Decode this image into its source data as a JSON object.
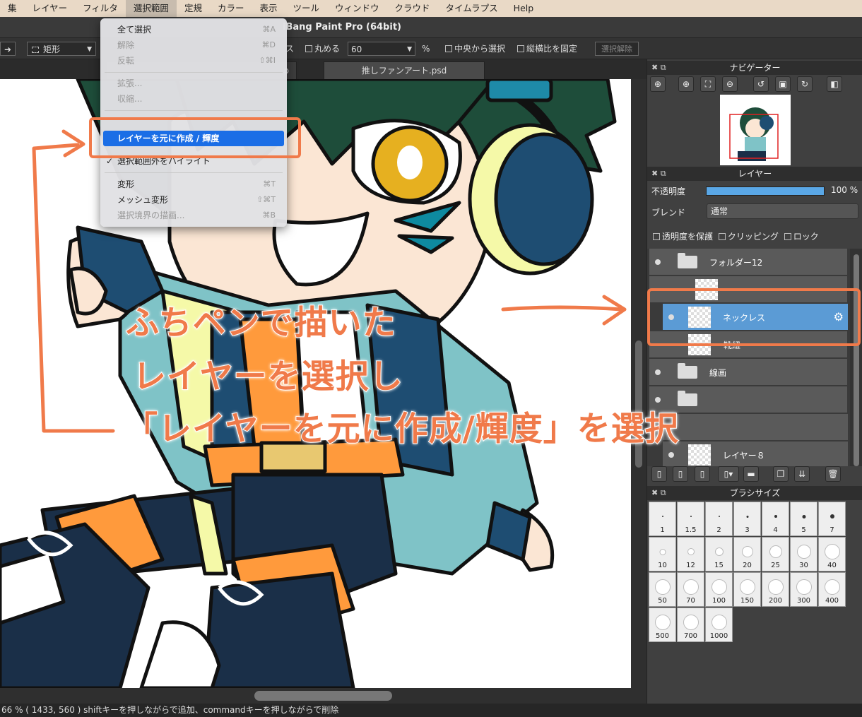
{
  "menubar": {
    "items": [
      "集",
      "レイヤー",
      "フィルタ",
      "選択範囲",
      "定規",
      "カラー",
      "表示",
      "ツール",
      "ウィンドウ",
      "クラウド",
      "タイムラプス",
      "Help"
    ],
    "active": "選択範囲"
  },
  "window": {
    "title": "iBang Paint Pro (64bit)"
  },
  "toolbar": {
    "arrow_icon": "arrow-right-icon",
    "shape_select": "矩形",
    "clip_text": "ス",
    "round_label": "丸める",
    "round_value": "60",
    "percent": "%",
    "center_label": "中央から選択",
    "aspect_label": "縦横比を固定",
    "deselect_label": "選択解除"
  },
  "tabs": {
    "left_fragment": "p",
    "active": "推しファンアート.psd"
  },
  "menu": {
    "select_all": {
      "label": "全て選択",
      "shortcut": "⌘A"
    },
    "deselect": {
      "label": "解除",
      "shortcut": "⌘D"
    },
    "invert": {
      "label": "反転",
      "shortcut": "⇧⌘I"
    },
    "expand": {
      "label": "拡張..."
    },
    "shrink": {
      "label": "収縮..."
    },
    "create_from_layer": {
      "label": "レイヤーを元に作成 / 輝度"
    },
    "highlight_outside": {
      "label": "選択範囲外をハイライト",
      "check": "✓"
    },
    "transform": {
      "label": "変形",
      "shortcut": "⌘T"
    },
    "mesh_transform": {
      "label": "メッシュ変形",
      "shortcut": "⇧⌘T"
    },
    "draw_border": {
      "label": "選択境界の描画...",
      "shortcut": "⌘B"
    }
  },
  "navigator": {
    "title": "ナビゲーター"
  },
  "layer_panel": {
    "title": "レイヤー",
    "opacity_label": "不透明度",
    "opacity_value": "100 %",
    "opacity_fraction": 1.0,
    "blend_label": "ブレンド",
    "blend_value": "通常",
    "protect_alpha": "透明度を保護",
    "clipping": "クリッピング",
    "lock": "ロック",
    "layers": [
      {
        "name": "フォルダー12",
        "type": "folder"
      },
      {
        "name": "ネックレス",
        "type": "layer",
        "selected": true
      },
      {
        "name": "靴紐",
        "type": "layer"
      },
      {
        "name": "線画",
        "type": "folder"
      },
      {
        "name": "レイヤー８",
        "type": "layer"
      }
    ]
  },
  "brush_panel": {
    "title": "ブラシサイズ",
    "sizes": [
      "1",
      "1.5",
      "2",
      "3",
      "4",
      "5",
      "7",
      "10",
      "12",
      "15",
      "20",
      "25",
      "30",
      "40",
      "50",
      "70",
      "100",
      "150",
      "200",
      "300",
      "400",
      "500",
      "700",
      "1000"
    ]
  },
  "status": {
    "text": "66 %  ( 1433, 560 )  shiftキーを押しながらで追加、commandキーを押しながらで削除"
  },
  "annotation": {
    "line1": "ふちペンで描いた",
    "line2": "レイヤーを選択し",
    "line3": "「レイヤーを元に作成/輝度」を選択"
  },
  "colors": {
    "accent": "#f07a4a",
    "menu_highlight": "#1b6ee6",
    "layer_selected": "#5b9bd5",
    "opacity_bar": "#5aa7e6"
  }
}
